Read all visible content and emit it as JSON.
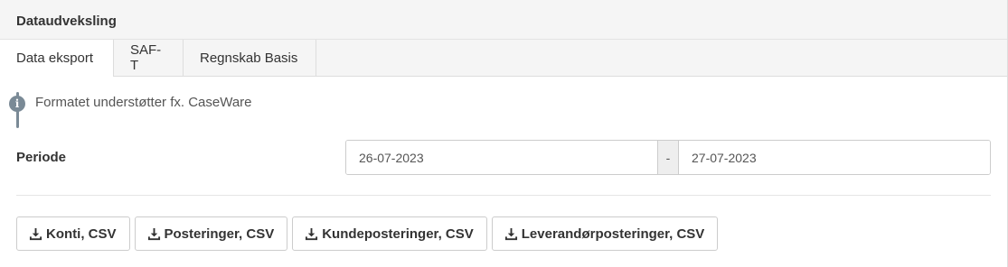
{
  "panel": {
    "title": "Dataudveksling"
  },
  "tabs": [
    {
      "label": "Data eksport",
      "active": true
    },
    {
      "label": "SAF-T",
      "active": false
    },
    {
      "label": "Regnskab Basis",
      "active": false
    }
  ],
  "info": {
    "icon": "info-icon",
    "text": "Formatet understøtter fx. CaseWare"
  },
  "period": {
    "label": "Periode",
    "from": "26-07-2023",
    "separator": "-",
    "to": "27-07-2023"
  },
  "export_buttons": [
    {
      "icon": "download-icon",
      "label": "Konti, CSV"
    },
    {
      "icon": "download-icon",
      "label": "Posteringer, CSV"
    },
    {
      "icon": "download-icon",
      "label": "Kundeposteringer, CSV"
    },
    {
      "icon": "download-icon",
      "label": "Leverandørposteringer, CSV"
    }
  ],
  "colors": {
    "info_accent": "#7a8a96",
    "header_bg": "#f5f5f5"
  }
}
